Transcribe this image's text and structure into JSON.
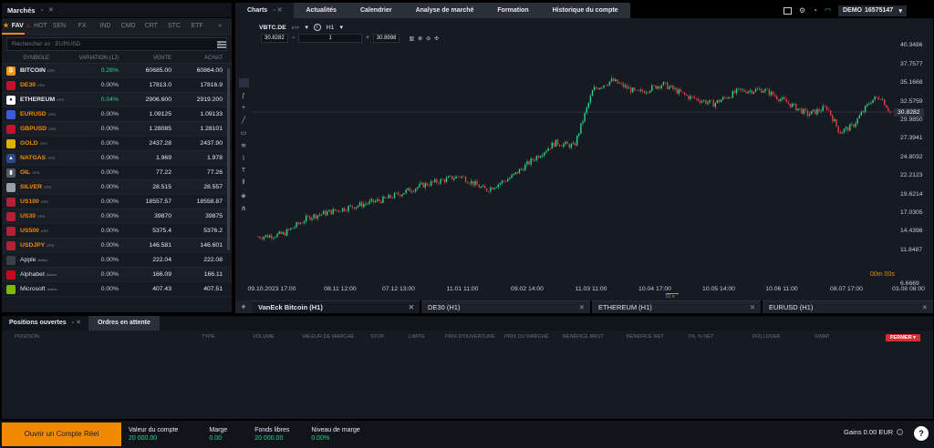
{
  "markets": {
    "title": "Marchés",
    "window_controls": "▫ ✕",
    "tabs": [
      {
        "label": "FAV",
        "active": true
      },
      {
        "label": "HOT"
      },
      {
        "label": "SEN"
      },
      {
        "label": "FX"
      },
      {
        "label": "IND"
      },
      {
        "label": "CMD"
      },
      {
        "label": "CRT"
      },
      {
        "label": "STC"
      },
      {
        "label": "ETF"
      },
      {
        "label": "»"
      }
    ],
    "search_placeholder": "Rechercher ex : EURUSD",
    "columns": [
      "SYMBOLE",
      "VARIATION (1J)",
      "VENTE",
      "ACHAT"
    ],
    "rows": [
      {
        "sym": "BITCOIN",
        "tag": "CFD",
        "var": "0.28%",
        "sell": "60685.00",
        "buy": "60864.00",
        "color": "#f7931a",
        "glyph": "₿",
        "style": "wh"
      },
      {
        "sym": "DE30",
        "tag": "CFD",
        "var": "0.00%",
        "sell": "17813.0",
        "buy": "17816.9",
        "color": "#c8102e",
        "glyph": "",
        "style": ""
      },
      {
        "sym": "ETHEREUM",
        "tag": "CFD",
        "var": "0.04%",
        "sell": "2906.600",
        "buy": "2919.200",
        "color": "#ffffff",
        "glyph": "♦",
        "style": "wh"
      },
      {
        "sym": "EURUSD",
        "tag": "CFD",
        "var": "0.00%",
        "sell": "1.09125",
        "buy": "1.09133",
        "color": "#3b5bdb",
        "glyph": "",
        "style": ""
      },
      {
        "sym": "GBPUSD",
        "tag": "CFD",
        "var": "0.00%",
        "sell": "1.28085",
        "buy": "1.28101",
        "color": "#c8102e",
        "glyph": "",
        "style": ""
      },
      {
        "sym": "GOLD",
        "tag": "CFD",
        "var": "0.00%",
        "sell": "2437.28",
        "buy": "2437.90",
        "color": "#e0b000",
        "glyph": "",
        "style": ""
      },
      {
        "sym": "NATGAS",
        "tag": "CFD",
        "var": "0.00%",
        "sell": "1.969",
        "buy": "1.978",
        "color": "#2b4a8a",
        "glyph": "▲",
        "style": ""
      },
      {
        "sym": "OIL",
        "tag": "CFD",
        "var": "0.00%",
        "sell": "77.22",
        "buy": "77.26",
        "color": "#555b66",
        "glyph": "▮",
        "style": ""
      },
      {
        "sym": "SILVER",
        "tag": "CFD",
        "var": "0.00%",
        "sell": "28.515",
        "buy": "28.557",
        "color": "#9aa0a8",
        "glyph": "",
        "style": ""
      },
      {
        "sym": "US100",
        "tag": "CFD",
        "var": "0.00%",
        "sell": "18557.57",
        "buy": "18558.87",
        "color": "#b22234",
        "glyph": "",
        "style": ""
      },
      {
        "sym": "US30",
        "tag": "CFD",
        "var": "0.00%",
        "sell": "39870",
        "buy": "39875",
        "color": "#b22234",
        "glyph": "",
        "style": ""
      },
      {
        "sym": "US500",
        "tag": "CFD",
        "var": "0.00%",
        "sell": "5375.4",
        "buy": "5376.2",
        "color": "#b22234",
        "glyph": "",
        "style": ""
      },
      {
        "sym": "USDJPY",
        "tag": "CFD",
        "var": "0.00%",
        "sell": "146.581",
        "buy": "146.601",
        "color": "#b22234",
        "glyph": "",
        "style": ""
      },
      {
        "sym": "Apple",
        "tag": "Action",
        "var": "0.00%",
        "sell": "222.04",
        "buy": "222.08",
        "color": "#3a3f48",
        "glyph": "",
        "style": "st"
      },
      {
        "sym": "Alphabet",
        "tag": "Action",
        "var": "0.00%",
        "sell": "166.09",
        "buy": "166.11",
        "color": "#d0021b",
        "glyph": "",
        "style": "st"
      },
      {
        "sym": "Microsoft",
        "tag": "Action",
        "var": "0.00%",
        "sell": "407.43",
        "buy": "407.51",
        "color": "#7fba00",
        "glyph": "",
        "style": "st"
      }
    ]
  },
  "charts": {
    "tabs": [
      {
        "label": "Charts",
        "active": true
      },
      {
        "label": "Actualités"
      },
      {
        "label": "Calendrier"
      },
      {
        "label": "Analyse de marché"
      },
      {
        "label": "Formation"
      },
      {
        "label": "Historique du compte"
      }
    ],
    "symbol": "VBTC.DE",
    "symbol_tag": "ETF",
    "timeframe": "H1",
    "price_left": "30.8282",
    "qty": "1",
    "price_right": "30.8998",
    "y_ticks": [
      "40.3486",
      "37.7577",
      "35.1668",
      "32.5759",
      "29.9850",
      "27.3941",
      "24.8032",
      "22.2123",
      "19.6214",
      "17.0305",
      "14.4396",
      "11.8487",
      "6.6669"
    ],
    "x_ticks": [
      "09.10.2023 17:00",
      "08.11 12:00",
      "07.12 13:00",
      "11.01 11:00",
      "09.02 14:00",
      "11.03 11:00",
      "10.04 17:00",
      "10.05 14:00",
      "10.06 11:00",
      "08.07 17:00",
      "03.08 08:00"
    ],
    "current_price": "30.8282",
    "countdown": "00m 00s",
    "bottom_tabs": [
      "VanEck Bitcoin (H1)",
      "DE30 (H1)",
      "ETHEREUM (H1)",
      "EURUSD (H1)"
    ],
    "add_tab": "+",
    "close_glyph": "✕",
    "period_marker": "01 ▾"
  },
  "positions": {
    "tabs": [
      "Positions ouvertes",
      "Ordres en attente"
    ],
    "columns": [
      "POSITION",
      "TYPE",
      "VOLUME",
      "VALEUR DE MARCHÉ",
      "STOP",
      "LIMITE",
      "PRIX D'OUVERTURE",
      "PRIX DU MARCHÉ",
      "BÉNÉFICE BRUT",
      "BÉNÉFICE NET",
      "P/L % NET",
      "ROLLOVER",
      "SWAP"
    ],
    "close_button": "FERMER ▾"
  },
  "account": {
    "demo_label": "DEMO",
    "account_number": "16575147",
    "open_real": "Ouvrir un Compte Réel",
    "stats": [
      {
        "label": "Valeur du compte",
        "value": "20 000.00"
      },
      {
        "label": "Marge",
        "value": "0.00"
      },
      {
        "label": "Fonds libres",
        "value": "20 000.00"
      },
      {
        "label": "Niveau de marge",
        "value": "0.00%"
      }
    ],
    "gains": "Gains 0.00 EUR",
    "help": "?"
  },
  "colors": {
    "accent": "#f18a00",
    "positive": "#2fd38b",
    "candle_up": "#2fd38b",
    "candle_down": "#e0433a",
    "close_button": "#d32f2f"
  }
}
